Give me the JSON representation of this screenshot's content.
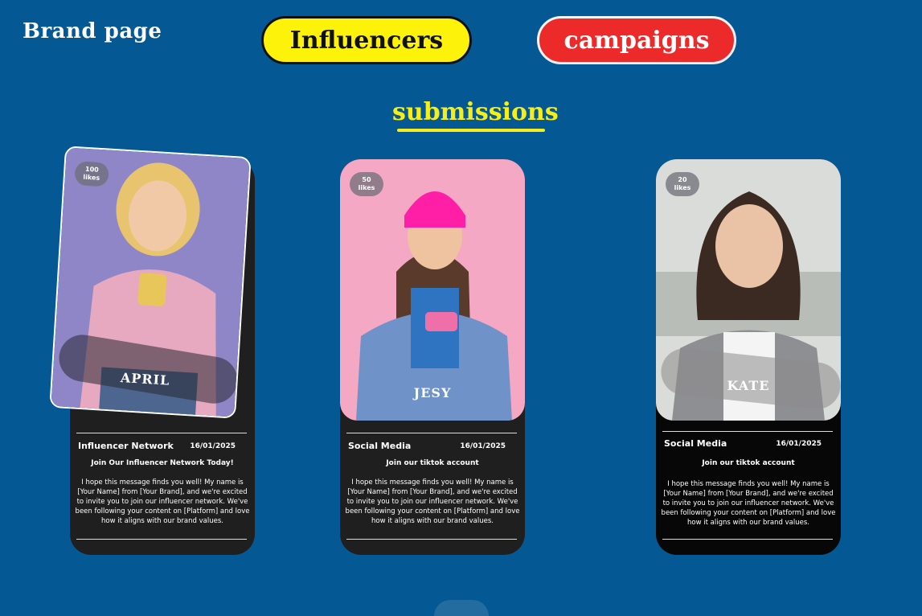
{
  "header": {
    "brand_title": "Brand page",
    "nav": {
      "influencers_label": "Influencers",
      "campaigns_label": "campaigns"
    }
  },
  "section": {
    "title": "submissions"
  },
  "colors": {
    "background": "#045893",
    "influencers_button": "#fdf30a",
    "campaigns_button": "#ec2a2a",
    "section_title": "#f5ee1a"
  },
  "cards": [
    {
      "likes_count": "100",
      "likes_unit": "likes",
      "name": "APRIL",
      "type": "Influencer Network",
      "date": "16/01/2025",
      "message_title": "Join Our Influencer Network Today!",
      "message_body": "I hope this message finds you well! My name is [Your Name] from [Your Brand], and we're excited to invite you to join our influencer network. We've been following your content on [Platform] and love how it aligns with our brand values."
    },
    {
      "likes_count": "50",
      "likes_unit": "likes",
      "name": "JESY",
      "type": "Social Media",
      "date": "16/01/2025",
      "message_title": "Join our tiktok account",
      "message_body": "I hope this message finds you well! My name is [Your Name] from [Your Brand], and we're excited to invite you to join our influencer network. We've been following your content on [Platform] and love how it aligns with our brand values."
    },
    {
      "likes_count": "20",
      "likes_unit": "likes",
      "name": "KATE",
      "type": "Social Media",
      "date": "16/01/2025",
      "message_title": "Join our tiktok account",
      "message_body": "I hope this message finds you well! My name is [Your Name] from [Your Brand], and we're excited to invite you to join our influencer network. We've been following your content on [Platform] and love how it aligns with our brand values."
    }
  ]
}
